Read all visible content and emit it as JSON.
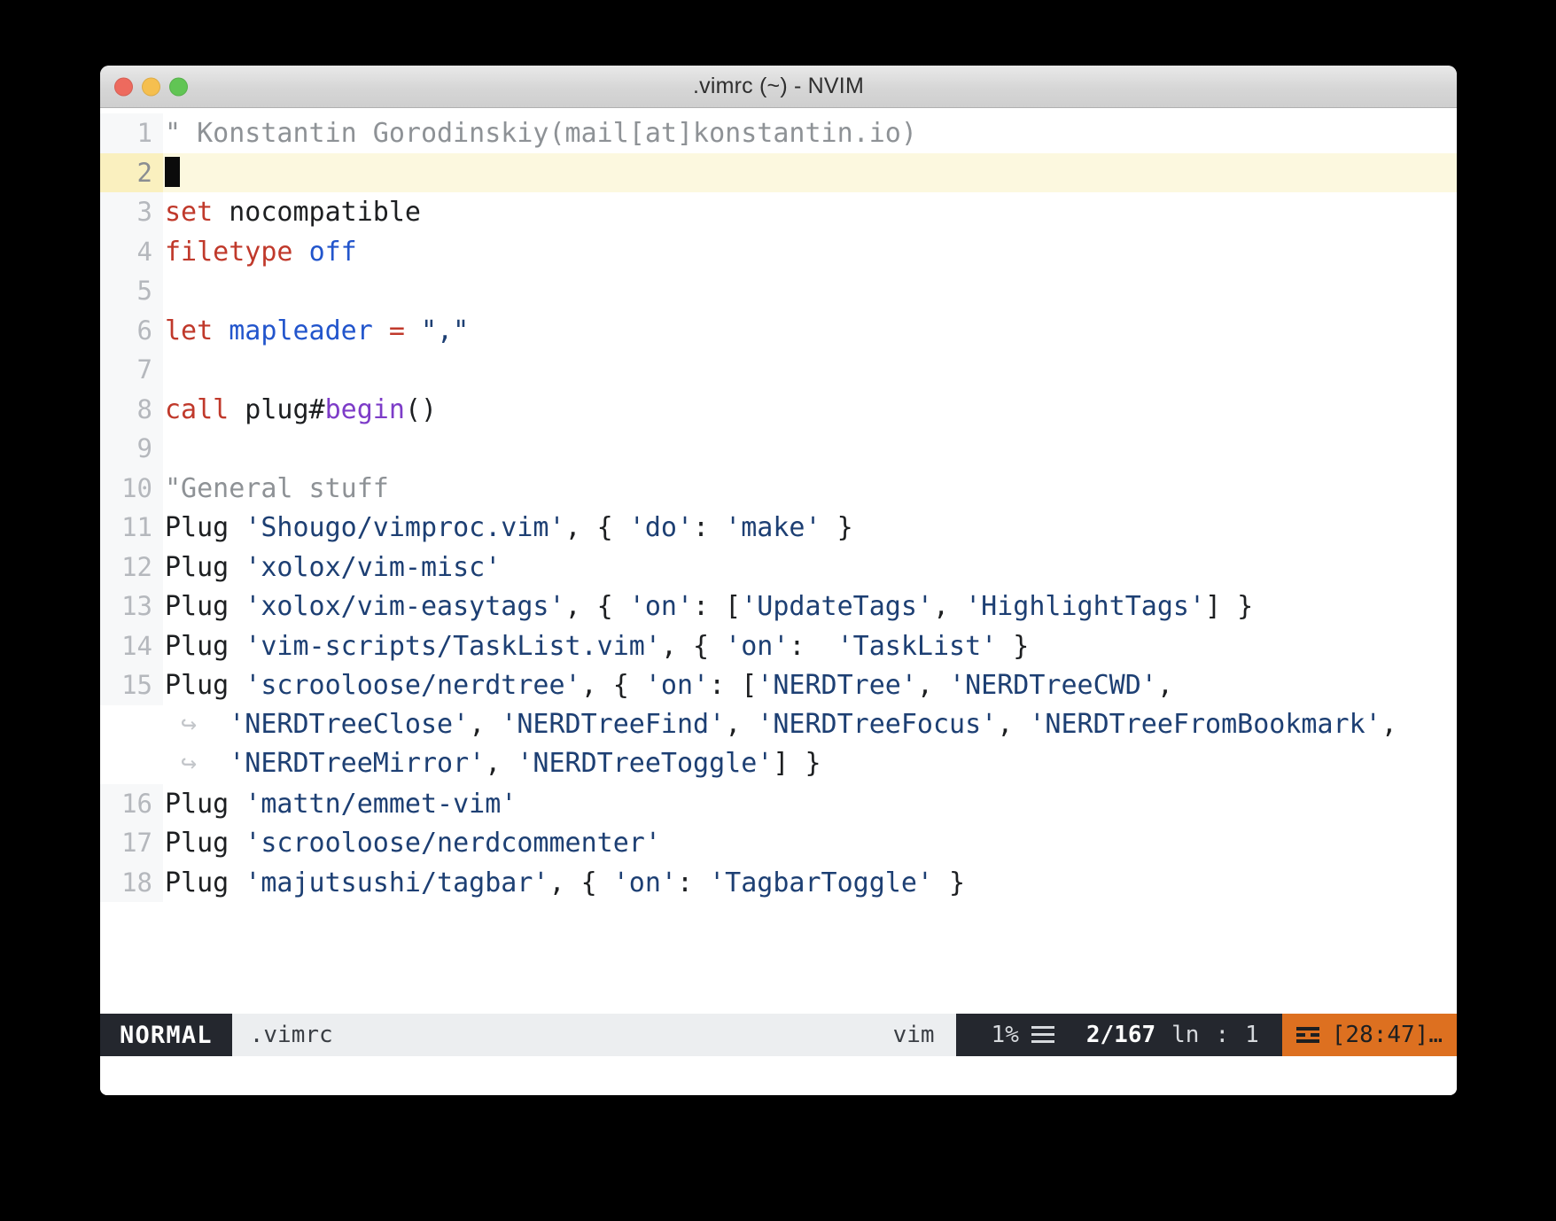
{
  "window": {
    "title": ".vimrc (~) - NVIM",
    "traffic_lights": [
      {
        "name": "close",
        "color": "#ed6a5e"
      },
      {
        "name": "minimize",
        "color": "#f5bf4f"
      },
      {
        "name": "maximize",
        "color": "#61c554"
      }
    ]
  },
  "editor": {
    "wrap_marker": "↪",
    "lines": [
      {
        "number": "1",
        "current": false,
        "tokens": [
          {
            "class": "t-comment",
            "text": "\" Konstantin Gorodinskiy(mail[at]konstantin.io)"
          }
        ]
      },
      {
        "number": "2",
        "current": true,
        "cursor": true,
        "tokens": []
      },
      {
        "number": "3",
        "current": false,
        "tokens": [
          {
            "class": "t-kw",
            "text": "set"
          },
          {
            "class": "t-plain",
            "text": " nocompatible"
          }
        ]
      },
      {
        "number": "4",
        "current": false,
        "tokens": [
          {
            "class": "t-kw",
            "text": "filetype"
          },
          {
            "class": "t-plain",
            "text": " "
          },
          {
            "class": "t-ident",
            "text": "off"
          }
        ]
      },
      {
        "number": "5",
        "current": false,
        "tokens": []
      },
      {
        "number": "6",
        "current": false,
        "tokens": [
          {
            "class": "t-kw",
            "text": "let"
          },
          {
            "class": "t-plain",
            "text": " "
          },
          {
            "class": "t-ident",
            "text": "mapleader"
          },
          {
            "class": "t-plain",
            "text": " "
          },
          {
            "class": "t-kw",
            "text": "="
          },
          {
            "class": "t-plain",
            "text": " "
          },
          {
            "class": "t-str",
            "text": "\",\""
          }
        ]
      },
      {
        "number": "7",
        "current": false,
        "tokens": []
      },
      {
        "number": "8",
        "current": false,
        "tokens": [
          {
            "class": "t-kw",
            "text": "call"
          },
          {
            "class": "t-plain",
            "text": " plug#"
          },
          {
            "class": "t-func",
            "text": "begin"
          },
          {
            "class": "t-plain",
            "text": "()"
          }
        ]
      },
      {
        "number": "9",
        "current": false,
        "tokens": []
      },
      {
        "number": "10",
        "current": false,
        "tokens": [
          {
            "class": "t-comment",
            "text": "\"General stuff"
          }
        ]
      },
      {
        "number": "11",
        "current": false,
        "tokens": [
          {
            "class": "t-plain",
            "text": "Plug "
          },
          {
            "class": "t-str",
            "text": "'Shougo/vimproc.vim'"
          },
          {
            "class": "t-plain",
            "text": ", { "
          },
          {
            "class": "t-str",
            "text": "'do'"
          },
          {
            "class": "t-plain",
            "text": ": "
          },
          {
            "class": "t-str",
            "text": "'make'"
          },
          {
            "class": "t-plain",
            "text": " }"
          }
        ]
      },
      {
        "number": "12",
        "current": false,
        "tokens": [
          {
            "class": "t-plain",
            "text": "Plug "
          },
          {
            "class": "t-str",
            "text": "'xolox/vim-misc'"
          }
        ]
      },
      {
        "number": "13",
        "current": false,
        "tokens": [
          {
            "class": "t-plain",
            "text": "Plug "
          },
          {
            "class": "t-str",
            "text": "'xolox/vim-easytags'"
          },
          {
            "class": "t-plain",
            "text": ", { "
          },
          {
            "class": "t-str",
            "text": "'on'"
          },
          {
            "class": "t-plain",
            "text": ": ["
          },
          {
            "class": "t-str",
            "text": "'UpdateTags'"
          },
          {
            "class": "t-plain",
            "text": ", "
          },
          {
            "class": "t-str",
            "text": "'HighlightTags'"
          },
          {
            "class": "t-plain",
            "text": "] }"
          }
        ]
      },
      {
        "number": "14",
        "current": false,
        "tokens": [
          {
            "class": "t-plain",
            "text": "Plug "
          },
          {
            "class": "t-str",
            "text": "'vim-scripts/TaskList.vim'"
          },
          {
            "class": "t-plain",
            "text": ", { "
          },
          {
            "class": "t-str",
            "text": "'on'"
          },
          {
            "class": "t-plain",
            "text": ":  "
          },
          {
            "class": "t-str",
            "text": "'TaskList'"
          },
          {
            "class": "t-plain",
            "text": " }"
          }
        ]
      },
      {
        "number": "15",
        "current": false,
        "tokens": [
          {
            "class": "t-plain",
            "text": "Plug "
          },
          {
            "class": "t-str",
            "text": "'scrooloose/nerdtree'"
          },
          {
            "class": "t-plain",
            "text": ", { "
          },
          {
            "class": "t-str",
            "text": "'on'"
          },
          {
            "class": "t-plain",
            "text": ": ["
          },
          {
            "class": "t-str",
            "text": "'NERDTree'"
          },
          {
            "class": "t-plain",
            "text": ", "
          },
          {
            "class": "t-str",
            "text": "'NERDTreeCWD'"
          },
          {
            "class": "t-plain",
            "text": ","
          }
        ]
      },
      {
        "number": "",
        "continuation": true,
        "current": false,
        "tokens": [
          {
            "class": "t-str",
            "text": "'NERDTreeClose'"
          },
          {
            "class": "t-plain",
            "text": ", "
          },
          {
            "class": "t-str",
            "text": "'NERDTreeFind'"
          },
          {
            "class": "t-plain",
            "text": ", "
          },
          {
            "class": "t-str",
            "text": "'NERDTreeFocus'"
          },
          {
            "class": "t-plain",
            "text": ", "
          },
          {
            "class": "t-str",
            "text": "'NERDTreeFromBookmark'"
          },
          {
            "class": "t-plain",
            "text": ","
          }
        ]
      },
      {
        "number": "",
        "continuation": true,
        "current": false,
        "tokens": [
          {
            "class": "t-str",
            "text": "'NERDTreeMirror'"
          },
          {
            "class": "t-plain",
            "text": ", "
          },
          {
            "class": "t-str",
            "text": "'NERDTreeToggle'"
          },
          {
            "class": "t-plain",
            "text": "] }"
          }
        ]
      },
      {
        "number": "16",
        "current": false,
        "tokens": [
          {
            "class": "t-plain",
            "text": "Plug "
          },
          {
            "class": "t-str",
            "text": "'mattn/emmet-vim'"
          }
        ]
      },
      {
        "number": "17",
        "current": false,
        "tokens": [
          {
            "class": "t-plain",
            "text": "Plug "
          },
          {
            "class": "t-str",
            "text": "'scrooloose/nerdcommenter'"
          }
        ]
      },
      {
        "number": "18",
        "current": false,
        "tokens": [
          {
            "class": "t-plain",
            "text": "Plug "
          },
          {
            "class": "t-str",
            "text": "'majutsushi/tagbar'"
          },
          {
            "class": "t-plain",
            "text": ", { "
          },
          {
            "class": "t-str",
            "text": "'on'"
          },
          {
            "class": "t-plain",
            "text": ": "
          },
          {
            "class": "t-str",
            "text": "'TagbarToggle'"
          },
          {
            "class": "t-plain",
            "text": " }"
          }
        ]
      }
    ]
  },
  "statusline": {
    "mode": "NORMAL",
    "filename": ".vimrc",
    "filetype": "vim",
    "percent": "1%",
    "position": "2/167",
    "line_label": "ln",
    "separator": ":",
    "column": "1",
    "right_segment": "[28:47]…",
    "accent_color": "#dd7020",
    "dark_color": "#24272e"
  }
}
